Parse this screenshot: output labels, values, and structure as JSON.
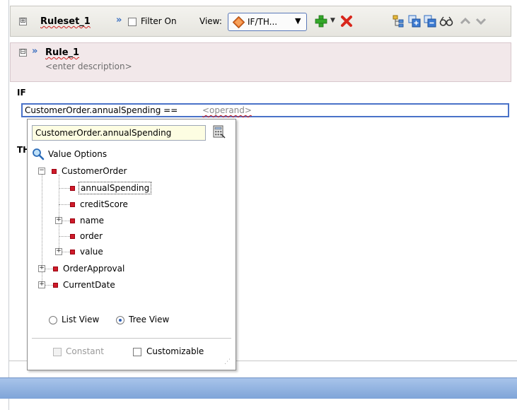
{
  "ruleset": {
    "expand_glyph": "⊞",
    "name": "Ruleset_1",
    "filter_label": "Filter On",
    "view_label": "View:",
    "view_value": "IF/TH...",
    "icons": [
      "expand-icon",
      "double-chevron-icon",
      "add-icon",
      "add-dropdown-icon",
      "delete-icon",
      "tree-icon",
      "expand-all-icon",
      "collapse-all-icon",
      "find-icon",
      "move-up-icon",
      "move-down-icon"
    ]
  },
  "rule": {
    "collapse_glyph": "⊟",
    "name": "Rule_1",
    "description": "<enter description>"
  },
  "if_label": "IF",
  "then_label": "TH",
  "condition": {
    "left": "CustomerOrder.annualSpending ==",
    "operand": "<operand>"
  },
  "popup": {
    "input_value": "CustomerOrder.annualSpending",
    "value_options_label": "Value Options",
    "tree": [
      {
        "label": "CustomerOrder",
        "expander": "−"
      },
      {
        "label": "annualSpending"
      },
      {
        "label": "creditScore"
      },
      {
        "label": "name",
        "expander": "+"
      },
      {
        "label": "order"
      },
      {
        "label": "value",
        "expander": "+"
      },
      {
        "label": "OrderApproval",
        "expander": "+"
      },
      {
        "label": "CurrentDate",
        "expander": "+"
      }
    ],
    "list_view_label": "List View",
    "tree_view_label": "Tree View",
    "selected_view": "Tree View",
    "constant_label": "Constant",
    "customizable_label": "Customizable"
  },
  "colors": {
    "accent_blue": "#4a72c8",
    "node_red": "#cf1b2a",
    "bottom_bar": "#8fb0df"
  }
}
